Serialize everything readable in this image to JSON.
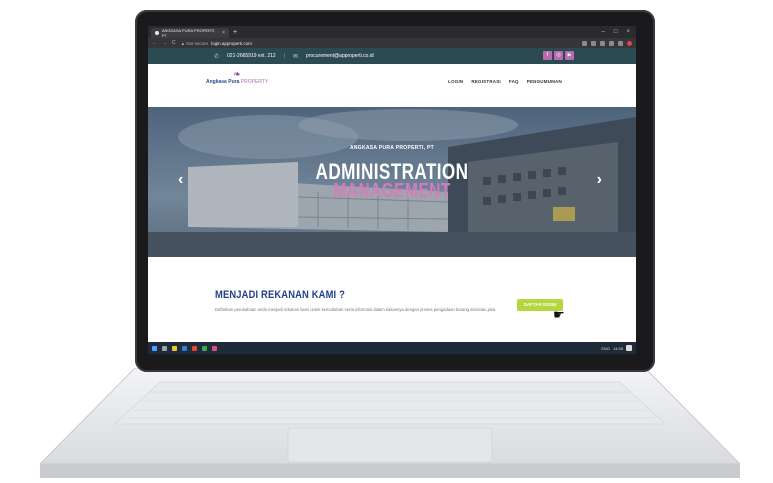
{
  "browser": {
    "tab_title": "ANGKASA PURA PROPERTI, PT",
    "new_tab_label": "+",
    "close_tab": "×",
    "window_controls": [
      "–",
      "□",
      "×"
    ],
    "security_label": "▲ Not secure",
    "url": "login.approperti.com",
    "nav_back": "←",
    "nav_forward": "→",
    "nav_reload": "C"
  },
  "topbar": {
    "phone_icon": "phone-icon",
    "phone": "021-2665919 ext. 212",
    "email_icon": "mail-icon",
    "email": "procurement@approperti.co.id",
    "social_icons": [
      "facebook-icon",
      "instagram-icon",
      "youtube-icon"
    ]
  },
  "logo": {
    "brand_main": "Angkasa Pura",
    "brand_sub": "PROPERTY"
  },
  "nav": {
    "items": [
      "LOGIN",
      "REGISTRASI",
      "FAQ",
      "PENGUMUMAN"
    ]
  },
  "hero": {
    "subtitle": "ANGKASA PURA PROPERTI, PT",
    "title_line1": "ADMINISTRATION",
    "title_line2": "MANAGEMENT",
    "prev_arrow": "‹",
    "next_arrow": "›"
  },
  "cta": {
    "title": "MENJADI REKANAN KAMI ?",
    "description": "Daftarkan perusahaan anda menjadi rekanan kami untuk kemudahan serta informasi dalam kaitannya dengan proses pengadaan barang dan/atau jasa",
    "button_label": "DAFTAR DISINI"
  },
  "taskbar": {
    "tray_text": "ENG",
    "time": "14:55"
  },
  "colors": {
    "topbar_bg": "#2c4a51",
    "accent_purple": "#b96ab0",
    "title_blue": "#22418a",
    "button_green": "#b5d63f"
  }
}
